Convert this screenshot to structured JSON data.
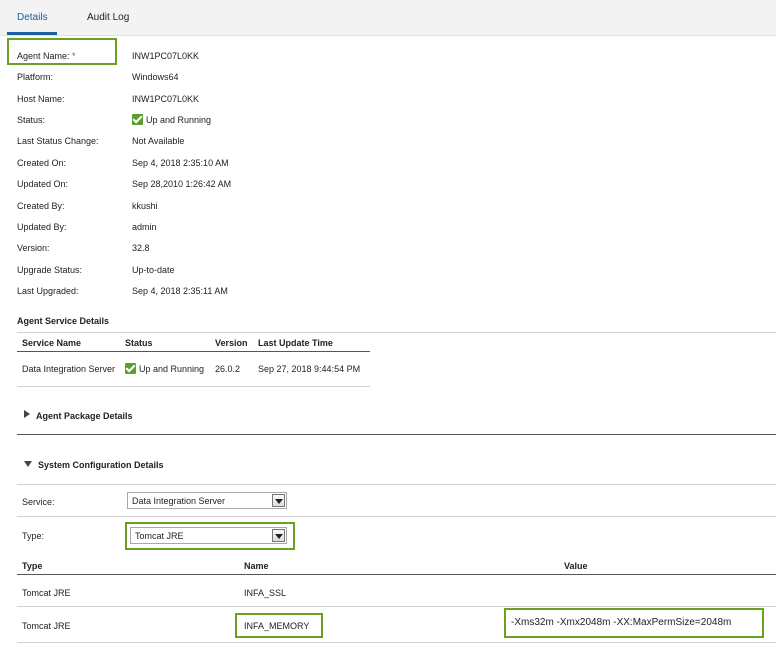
{
  "tabs": [
    {
      "label": "Details",
      "active": true
    },
    {
      "label": "Audit Log",
      "active": false
    }
  ],
  "details": {
    "agent_name_label": "Agent Name:",
    "required_marker": "*",
    "rows": [
      {
        "label": "Agent Name:",
        "value": "INW1PC07L0KK"
      },
      {
        "label": "Platform:",
        "value": "Windows64"
      },
      {
        "label": "Host Name:",
        "value": "INW1PC07L0KK"
      },
      {
        "label": "Status:",
        "value": "Up and Running"
      },
      {
        "label": "Last Status Change:",
        "value": "Not Available"
      },
      {
        "label": "Created On:",
        "value": "Sep 4, 2018 2:35:10 AM"
      },
      {
        "label": "Updated On:",
        "value": "Sep 28,2010  1:26:42 AM"
      },
      {
        "label": "Created By:",
        "value": "kkushi"
      },
      {
        "label": "Updated By:",
        "value": "admin"
      },
      {
        "label": "Version:",
        "value": "32.8"
      },
      {
        "label": "Upgrade Status:",
        "value": "Up-to-date"
      },
      {
        "label": "Last Upgraded:",
        "value": "Sep 4, 2018  2:35:11 AM"
      }
    ]
  },
  "agent_service": {
    "title": "Agent Service Details",
    "headers": [
      "Service Name",
      "Status",
      "Version",
      "Last Update Time"
    ],
    "row": {
      "service": "Data Integration Server",
      "status": "Up and Running",
      "version": "26.0.2",
      "last_update": "Sep 27, 2018  9:44:54 PM"
    }
  },
  "package_section": {
    "title": "Agent Package Details",
    "expanded": false
  },
  "system_config": {
    "title": "System Configuration Details",
    "expanded": true,
    "service_label": "Service:",
    "service_value": "Data Integration Server",
    "type_label": "Type:",
    "type_value": "Tomcat JRE",
    "headers": [
      "Type",
      "Name",
      "Value"
    ],
    "rows": [
      {
        "type": "Tomcat JRE",
        "name": "INFA_SSL",
        "value": ""
      },
      {
        "type": "Tomcat JRE",
        "name": "INFA_MEMORY",
        "value": "-Xms32m -Xmx2048m -XX:MaxPermSize=2048m"
      }
    ]
  },
  "colors": {
    "accent": "#1a5fa0",
    "highlight": "#6aa121",
    "status_green": "#5aa02c",
    "required": "#c0392b"
  },
  "icons": {
    "status": "check-icon",
    "collapsed": "triangle-right-icon",
    "expanded": "triangle-down-icon",
    "dropdown": "chevron-down-icon"
  }
}
